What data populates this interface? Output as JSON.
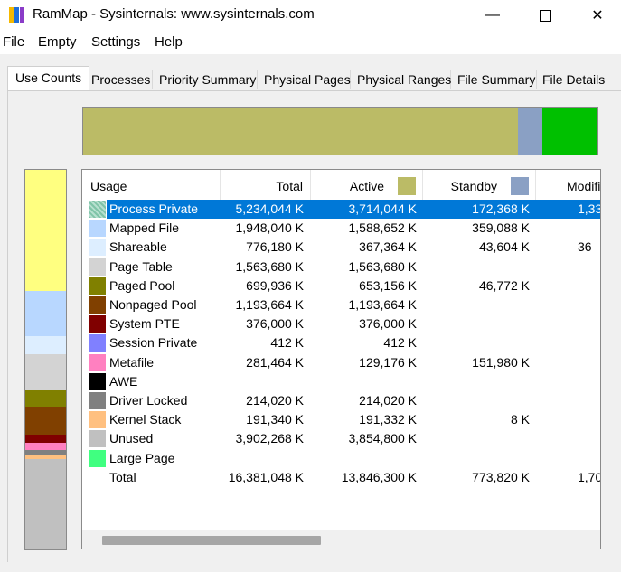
{
  "window": {
    "title": "RamMap - Sysinternals: www.sysinternals.com",
    "min_glyph": "—",
    "close_glyph": "✕"
  },
  "menu": [
    "File",
    "Empty",
    "Settings",
    "Help"
  ],
  "tabs": [
    "Use Counts",
    "Processes",
    "Priority Summary",
    "Physical Pages",
    "Physical Ranges",
    "File Summary",
    "File Details"
  ],
  "active_tab": "Use Counts",
  "colors": {
    "active": "#bbbb66",
    "standby": "#8aa0c4",
    "modified": "#00c000",
    "selection": "#0078d7"
  },
  "top_bar": [
    {
      "name": "Active",
      "fraction": 0.846,
      "color": "#bbbb66"
    },
    {
      "name": "Standby",
      "fraction": 0.047,
      "color": "#8aa0c4"
    },
    {
      "name": "Modified",
      "fraction": 0.107,
      "color": "#00c000"
    }
  ],
  "left_bar": [
    {
      "usage": "Process Private",
      "fraction": 0.32,
      "color": "#ffff80"
    },
    {
      "usage": "Mapped File",
      "fraction": 0.119,
      "color": "#b8d7ff"
    },
    {
      "usage": "Shareable",
      "fraction": 0.047,
      "color": "#ddeeff"
    },
    {
      "usage": "Page Table",
      "fraction": 0.095,
      "color": "#d3d3d3"
    },
    {
      "usage": "Paged Pool",
      "fraction": 0.043,
      "color": "#808000"
    },
    {
      "usage": "Nonpaged Pool",
      "fraction": 0.073,
      "color": "#804000"
    },
    {
      "usage": "System PTE",
      "fraction": 0.023,
      "color": "#800000"
    },
    {
      "usage": "Metafile",
      "fraction": 0.017,
      "color": "#ff80c0"
    },
    {
      "usage": "Driver Locked",
      "fraction": 0.013,
      "color": "#808080"
    },
    {
      "usage": "Kernel Stack",
      "fraction": 0.012,
      "color": "#ffc080"
    },
    {
      "usage": "Unused",
      "fraction": 0.238,
      "color": "#c0c0c0"
    }
  ],
  "columns": {
    "usage": "Usage",
    "total": "Total",
    "active": "Active",
    "standby": "Standby",
    "modified": "Modifie"
  },
  "rows": [
    {
      "usage": "Process Private",
      "color": "#9fd3bf",
      "total": "5,234,044 K",
      "active": "3,714,044 K",
      "standby": "172,368 K",
      "modified": "1,33",
      "selected": true
    },
    {
      "usage": "Mapped File",
      "color": "#b8d7ff",
      "total": "1,948,040 K",
      "active": "1,588,652 K",
      "standby": "359,088 K",
      "modified": ""
    },
    {
      "usage": "Shareable",
      "color": "#ddeeff",
      "total": "776,180 K",
      "active": "367,364 K",
      "standby": "43,604 K",
      "modified": "36"
    },
    {
      "usage": "Page Table",
      "color": "#d3d3d3",
      "total": "1,563,680 K",
      "active": "1,563,680 K",
      "standby": "",
      "modified": ""
    },
    {
      "usage": "Paged Pool",
      "color": "#808000",
      "total": "699,936 K",
      "active": "653,156 K",
      "standby": "46,772 K",
      "modified": ""
    },
    {
      "usage": "Nonpaged Pool",
      "color": "#804000",
      "total": "1,193,664 K",
      "active": "1,193,664 K",
      "standby": "",
      "modified": ""
    },
    {
      "usage": "System PTE",
      "color": "#800000",
      "total": "376,000 K",
      "active": "376,000 K",
      "standby": "",
      "modified": ""
    },
    {
      "usage": "Session Private",
      "color": "#8080ff",
      "total": "412 K",
      "active": "412 K",
      "standby": "",
      "modified": ""
    },
    {
      "usage": "Metafile",
      "color": "#ff80c0",
      "total": "281,464 K",
      "active": "129,176 K",
      "standby": "151,980 K",
      "modified": ""
    },
    {
      "usage": "AWE",
      "color": "#000000",
      "total": "",
      "active": "",
      "standby": "",
      "modified": ""
    },
    {
      "usage": "Driver Locked",
      "color": "#808080",
      "total": "214,020 K",
      "active": "214,020 K",
      "standby": "",
      "modified": ""
    },
    {
      "usage": "Kernel Stack",
      "color": "#ffc080",
      "total": "191,340 K",
      "active": "191,332 K",
      "standby": "8 K",
      "modified": ""
    },
    {
      "usage": "Unused",
      "color": "#c0c0c0",
      "total": "3,902,268 K",
      "active": "3,854,800 K",
      "standby": "",
      "modified": ""
    },
    {
      "usage": "Large Page",
      "color": "#40ff80",
      "total": "",
      "active": "",
      "standby": "",
      "modified": ""
    },
    {
      "usage": "Total",
      "color": "",
      "total": "16,381,048 K",
      "active": "13,846,300 K",
      "standby": "773,820 K",
      "modified": "1,70"
    }
  ]
}
